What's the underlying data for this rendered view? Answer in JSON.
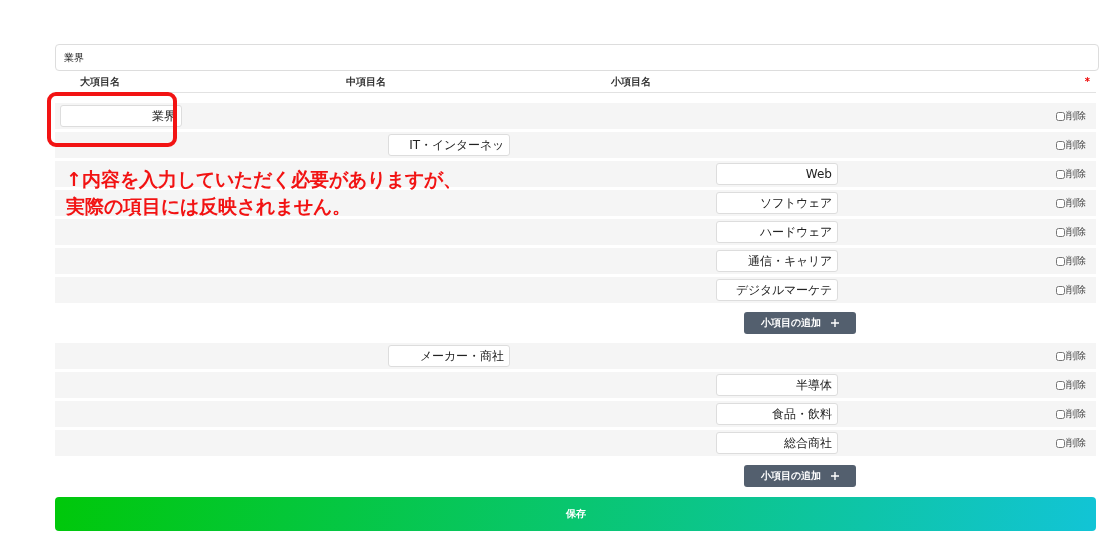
{
  "category_field": {
    "value": "業界"
  },
  "columns": [
    "大項目名",
    "中項目名",
    "小項目名"
  ],
  "required_mark": "*",
  "rows": [
    {
      "kind": "large",
      "value": "業界",
      "delete_label": "削除",
      "checked": false
    },
    {
      "kind": "medium",
      "value": "IT・インターネッ",
      "delete_label": "削除",
      "checked": false
    },
    {
      "kind": "small",
      "value": "Web",
      "delete_label": "削除",
      "checked": false
    },
    {
      "kind": "small",
      "value": "ソフトウェア",
      "delete_label": "削除",
      "checked": false
    },
    {
      "kind": "small",
      "value": "ハードウェア",
      "delete_label": "削除",
      "checked": false
    },
    {
      "kind": "small",
      "value": "通信・キャリア",
      "delete_label": "削除",
      "checked": false
    },
    {
      "kind": "small",
      "value": "デジタルマーケテ",
      "delete_label": "削除",
      "checked": false
    },
    {
      "kind": "add",
      "value": "小項目の追加"
    },
    {
      "kind": "medium",
      "value": "メーカー・商社",
      "delete_label": "削除",
      "checked": false
    },
    {
      "kind": "small",
      "value": "半導体",
      "delete_label": "削除",
      "checked": false
    },
    {
      "kind": "small",
      "value": "食品・飲料",
      "delete_label": "削除",
      "checked": false
    },
    {
      "kind": "small",
      "value": "総合商社",
      "delete_label": "削除",
      "checked": false
    },
    {
      "kind": "add",
      "value": "小項目の追加"
    }
  ],
  "save_button": "保存",
  "annotation": {
    "lines": [
      "↑内容を入力していただく必要がありますが、",
      "実際の項目には反映されません。"
    ]
  }
}
